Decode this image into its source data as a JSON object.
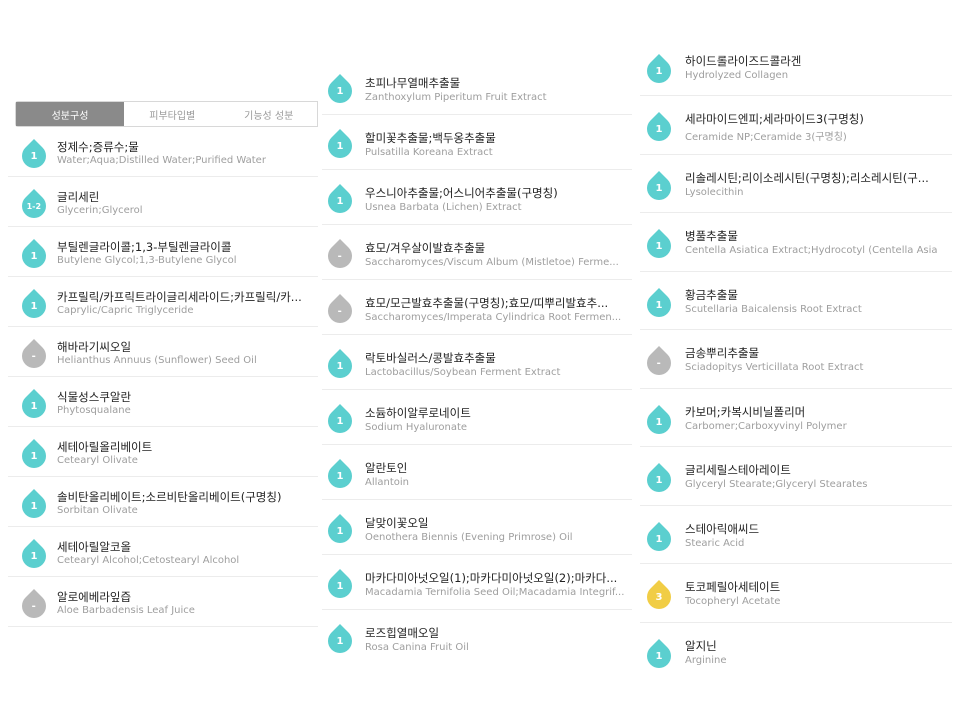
{
  "tabs": [
    {
      "label": "성분구성",
      "active": true
    },
    {
      "label": "피부타입별",
      "active": false
    },
    {
      "label": "기능성 성분",
      "active": false
    }
  ],
  "grade_colors": {
    "1": "#5bcfcf",
    "1-2": "#5bcfcf",
    "-": "#b9b9b9",
    "3": "#f1cd45"
  },
  "columns": [
    [
      {
        "grade": "1",
        "ko": "정제수;증류수;물",
        "en": "Water;Aqua;Distilled Water;Purified Water"
      },
      {
        "grade": "1-2",
        "ko": "글리세린",
        "en": "Glycerin;Glycerol"
      },
      {
        "grade": "1",
        "ko": "부틸렌글라이콜;1,3-부틸렌글라이콜",
        "en": "Butylene Glycol;1,3-Butylene Glycol"
      },
      {
        "grade": "1",
        "ko": "카프릴릭/카프릭트라이글리세라이드;카프릴릭/카...",
        "en": "Caprylic/Capric Triglyceride"
      },
      {
        "grade": "-",
        "ko": "해바라기씨오일",
        "en": "Helianthus Annuus (Sunflower) Seed Oil"
      },
      {
        "grade": "1",
        "ko": "식물성스쿠알란",
        "en": "Phytosqualane"
      },
      {
        "grade": "1",
        "ko": "세테아릴올리베이트",
        "en": "Cetearyl Olivate"
      },
      {
        "grade": "1",
        "ko": "솔비탄올리베이트;소르비탄올리베이트(구명칭)",
        "en": "Sorbitan Olivate"
      },
      {
        "grade": "1",
        "ko": "세테아릴알코올",
        "en": "Cetearyl Alcohol;Cetostearyl Alcohol"
      },
      {
        "grade": "-",
        "ko": "알로에베라잎즙",
        "en": "Aloe Barbadensis Leaf Juice"
      }
    ],
    [
      {
        "grade": "1",
        "ko": "초피나무열매추출물",
        "en": "Zanthoxylum Piperitum Fruit Extract"
      },
      {
        "grade": "1",
        "ko": "할미꽃추출물;백두옹추출물",
        "en": "Pulsatilla Koreana Extract"
      },
      {
        "grade": "1",
        "ko": "우스니아추출물;어스니어추출물(구명칭)",
        "en": "Usnea Barbata (Lichen) Extract"
      },
      {
        "grade": "-",
        "ko": "효모/겨우살이발효추출물",
        "en": "Saccharomyces/Viscum Album (Mistletoe) Ferme..."
      },
      {
        "grade": "-",
        "ko": "효모/모근발효추출물(구명칭);효모/띠뿌리발효추...",
        "en": "Saccharomyces/Imperata Cylindrica Root Fermen..."
      },
      {
        "grade": "1",
        "ko": "락토바실러스/콩발효추출물",
        "en": "Lactobacillus/Soybean Ferment Extract"
      },
      {
        "grade": "1",
        "ko": "소듐하이알루로네이트",
        "en": "Sodium Hyaluronate"
      },
      {
        "grade": "1",
        "ko": "알란토인",
        "en": "Allantoin"
      },
      {
        "grade": "1",
        "ko": "달맞이꽃오일",
        "en": "Oenothera Biennis (Evening Primrose) Oil"
      },
      {
        "grade": "1",
        "ko": "마카다미아넛오일(1);마카다미아넛오일(2);마카다...",
        "en": "Macadamia Ternifolia Seed Oil;Macadamia Integrif..."
      },
      {
        "grade": "1",
        "ko": "로즈힙열매오일",
        "en": "Rosa Canina Fruit Oil"
      }
    ],
    [
      {
        "grade": "1",
        "ko": "하이드롤라이즈드콜라겐",
        "en": "Hydrolyzed Collagen"
      },
      {
        "grade": "1",
        "ko": "세라마이드엔피;세라마이드3(구명칭)",
        "en": "Ceramide NP;Ceramide 3(구명칭)"
      },
      {
        "grade": "1",
        "ko": "리솔레시틴;리이소레시틴(구명칭);리소레시틴(구...",
        "en": "Lysolecithin"
      },
      {
        "grade": "1",
        "ko": "병풀추출물",
        "en": "Centella Asiatica Extract;Hydrocotyl (Centella Asia"
      },
      {
        "grade": "1",
        "ko": "황금추출물",
        "en": "Scutellaria Baicalensis Root Extract"
      },
      {
        "grade": "-",
        "ko": "금송뿌리추출물",
        "en": "Sciadopitys Verticillata Root Extract"
      },
      {
        "grade": "1",
        "ko": "카보머;카복시비닐폴리머",
        "en": "Carbomer;Carboxyvinyl Polymer"
      },
      {
        "grade": "1",
        "ko": "글리세릴스테아레이트",
        "en": "Glyceryl Stearate;Glyceryl Stearates"
      },
      {
        "grade": "1",
        "ko": "스테아릭애씨드",
        "en": "Stearic Acid"
      },
      {
        "grade": "3",
        "ko": "토코페릴아세테이트",
        "en": "Tocopheryl Acetate"
      },
      {
        "grade": "1",
        "ko": "알지닌",
        "en": "Arginine"
      }
    ]
  ]
}
